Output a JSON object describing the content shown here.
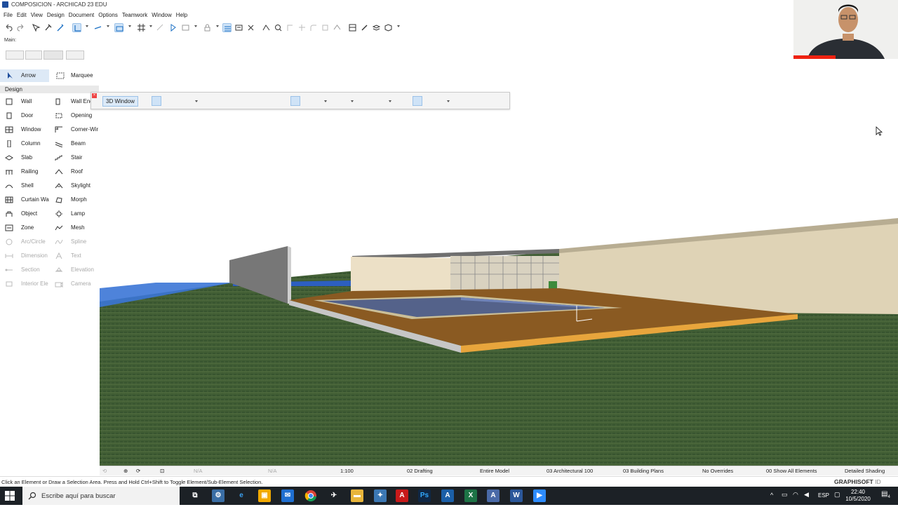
{
  "window": {
    "title": "COMPOSICION - ARCHICAD 23 EDU"
  },
  "menu": [
    "File",
    "Edit",
    "View",
    "Design",
    "Document",
    "Options",
    "Teamwork",
    "Window",
    "Help"
  ],
  "main_label": "Main:",
  "toolbox": {
    "top_tools": [
      {
        "label": "Arrow",
        "icon": "arrow-icon",
        "selected": true
      },
      {
        "label": "Marquee",
        "icon": "marquee-icon"
      }
    ],
    "section": "Design",
    "tools": [
      {
        "label": "Wall",
        "icon": "wall-icon"
      },
      {
        "label": "Wall End",
        "icon": "wall-end-icon"
      },
      {
        "label": "Door",
        "icon": "door-icon"
      },
      {
        "label": "Opening",
        "icon": "opening-icon"
      },
      {
        "label": "Window",
        "icon": "window-icon"
      },
      {
        "label": "Corner-Wir",
        "icon": "corner-window-icon"
      },
      {
        "label": "Column",
        "icon": "column-icon"
      },
      {
        "label": "Beam",
        "icon": "beam-icon"
      },
      {
        "label": "Slab",
        "icon": "slab-icon"
      },
      {
        "label": "Stair",
        "icon": "stair-icon"
      },
      {
        "label": "Railing",
        "icon": "railing-icon"
      },
      {
        "label": "Roof",
        "icon": "roof-icon"
      },
      {
        "label": "Shell",
        "icon": "shell-icon"
      },
      {
        "label": "Skylight",
        "icon": "skylight-icon"
      },
      {
        "label": "Curtain Wa",
        "icon": "curtain-wall-icon"
      },
      {
        "label": "Morph",
        "icon": "morph-icon"
      },
      {
        "label": "Object",
        "icon": "object-icon"
      },
      {
        "label": "Lamp",
        "icon": "lamp-icon"
      },
      {
        "label": "Zone",
        "icon": "zone-icon"
      },
      {
        "label": "Mesh",
        "icon": "mesh-icon"
      },
      {
        "label": "Arc/Circle",
        "icon": "arc-circle-icon",
        "disabled": true
      },
      {
        "label": "Spline",
        "icon": "spline-icon",
        "disabled": true
      },
      {
        "label": "Dimension",
        "icon": "dimension-icon",
        "disabled": true
      },
      {
        "label": "Text",
        "icon": "text-icon",
        "disabled": true
      },
      {
        "label": "Section",
        "icon": "section-icon",
        "disabled": true
      },
      {
        "label": "Elevation",
        "icon": "elevation-icon",
        "disabled": true
      },
      {
        "label": "Interior Ele",
        "icon": "interior-elevation-icon",
        "disabled": true
      },
      {
        "label": "Camera",
        "icon": "camera-icon",
        "disabled": true
      }
    ]
  },
  "toolbar3d": {
    "window_label": "3D Window"
  },
  "navbar": {
    "na1": "N/A",
    "na2": "N/A",
    "scale": "1:100",
    "layer_combo": "02 Drafting",
    "model_view": "Entire Model",
    "pen_set": "03 Architectural 100",
    "model_view_options": "03 Building Plans",
    "overrides": "No Overrides",
    "renovation": "00 Show All Elements",
    "shading": "Detailed Shading"
  },
  "hint": "Click an Element or Draw a Selection Area. Press and Hold Ctrl+Shift to Toggle Element/Sub-Element Selection.",
  "brand": {
    "name": "GRAPHISOFT",
    "suffix": "ID"
  },
  "taskbar": {
    "search_placeholder": "Escribe aquí para buscar",
    "lang": "ESP",
    "time": "22:40",
    "date": "10/5/2020",
    "notifications": "4"
  },
  "colors": {
    "accent": "#1f4e9c",
    "grass": "#3f5b33",
    "deck": "#8a5a22",
    "water": "#4a78c8"
  }
}
